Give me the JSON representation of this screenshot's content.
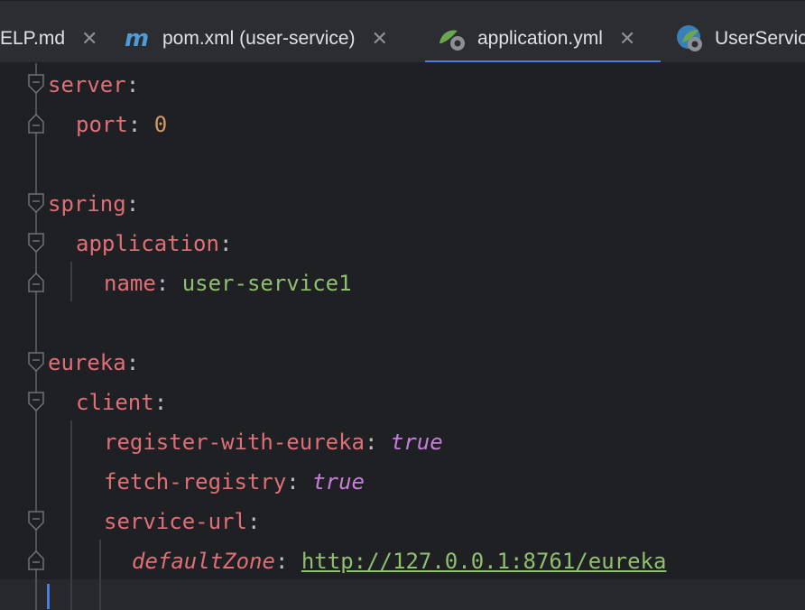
{
  "tabs": [
    {
      "label": "ELP.md",
      "icon": "markdown-icon"
    },
    {
      "label": "pom.xml (user-service)",
      "icon": "maven-icon"
    },
    {
      "label": "application.yml",
      "icon": "spring-yaml-icon",
      "active": true
    },
    {
      "label": "UserServic",
      "icon": "spring-class-icon"
    }
  ],
  "code": {
    "l1_key": "server",
    "l1_colon": ":",
    "l2_key": "port",
    "l2_colon": ": ",
    "l2_val": "0",
    "l4_key": "spring",
    "l4_colon": ":",
    "l5_key": "application",
    "l5_colon": ":",
    "l6_key": "name",
    "l6_colon": ": ",
    "l6_val": "user-service1",
    "l8_key": "eureka",
    "l8_colon": ":",
    "l9_key": "client",
    "l9_colon": ":",
    "l10_key": "register-with-eureka",
    "l10_colon": ": ",
    "l10_val": "true",
    "l11_key": "fetch-registry",
    "l11_colon": ": ",
    "l11_val": "true",
    "l12_key": "service-url",
    "l12_colon": ":",
    "l13_key": "defaultZone",
    "l13_colon": ": ",
    "l13_val": "http://127.0.0.1:8761/eureka"
  },
  "colors": {
    "active_tab_underline": "#4d7cdf",
    "key": "#df6f77",
    "string": "#8fbf6f",
    "bool": "#c77dda",
    "number": "#d19a66"
  }
}
